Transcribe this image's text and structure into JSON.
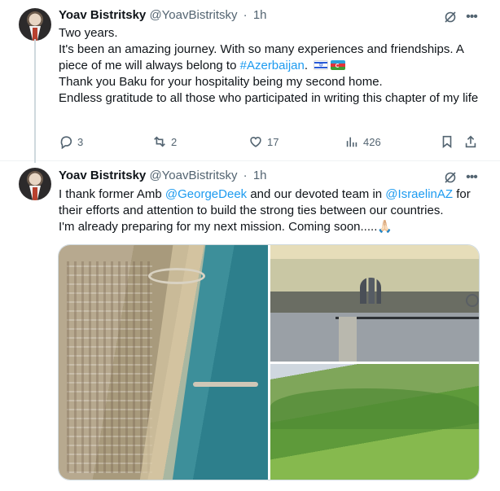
{
  "tweets": [
    {
      "author_name": "Yoav Bistritsky",
      "handle": "@YoavBistritsky",
      "time": "1h",
      "lines": [
        "Two years.",
        "It's been an amazing journey. With so many experiences and friendships. A piece of me will always belong to",
        "#Azerbaijan",
        "Thank you Baku for your hospitality being my second home.",
        "Endless gratitude to all those who participated in writing this chapter of my life"
      ],
      "replies": "3",
      "reposts": "2",
      "likes": "17",
      "views": "426"
    },
    {
      "author_name": "Yoav Bistritsky",
      "handle": "@YoavBistritsky",
      "time": "1h",
      "text_a": "I thank former Amb",
      "mention_1": "@GeorgeDeek",
      "text_b": "and our devoted team in",
      "mention_2": "@IsraelinAZ",
      "text_c": "for their efforts and attention to build the strong ties between our countries.",
      "text_d": "I'm already preparing for my next mission. Coming soon.....",
      "pray_emoji": "🙏🏻"
    }
  ],
  "icons": {
    "grok": "grok-icon",
    "more": "more-icon",
    "reply": "reply-icon",
    "repost": "repost-icon",
    "like": "heart-icon",
    "views": "views-icon",
    "bookmark": "bookmark-icon",
    "share": "share-icon"
  },
  "colors": {
    "link": "#1d9bf0",
    "secondary_text": "#536471",
    "primary_text": "#0f1419"
  }
}
